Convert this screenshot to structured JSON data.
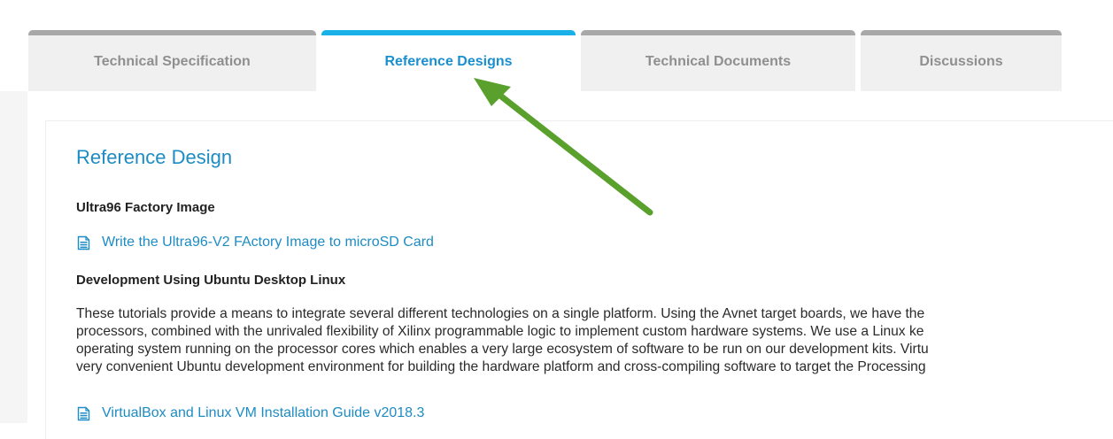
{
  "tabs": [
    {
      "label": "Technical Specification",
      "active": false
    },
    {
      "label": "Reference Designs",
      "active": true
    },
    {
      "label": "Technical Documents",
      "active": false
    },
    {
      "label": "Discussions",
      "active": false
    }
  ],
  "main": {
    "heading": "Reference Design",
    "sections": [
      {
        "title": "Ultra96 Factory Image",
        "links": [
          {
            "label": "Write the Ultra96-V2 FActory Image to microSD Card",
            "icon": "document-icon"
          }
        ]
      },
      {
        "title": "Development Using Ubuntu Desktop Linux",
        "paragraph_lines": [
          "These tutorials provide a means to integrate several different technologies on a single platform. Using the Avnet target boards, we have the",
          "processors, combined with the unrivaled flexibility of Xilinx programmable logic to implement custom hardware systems. We use a Linux ke",
          "operating system running on the processor cores which enables a very large ecosystem of software to be run on our development kits. Virtu",
          "very convenient Ubuntu development environment for building the hardware platform and cross-compiling software to target the Processing"
        ],
        "links": [
          {
            "label": "VirtualBox and Linux VM Installation Guide v2018.3",
            "icon": "document-icon"
          }
        ]
      }
    ]
  },
  "annotation": {
    "type": "arrow",
    "color": "#5aa02c",
    "points_to": "Reference Designs tab"
  },
  "colors": {
    "accent": "#1ab0e8",
    "link": "#1d8cc4",
    "tab_inactive_border": "#a8a8a8",
    "tab_inactive_bg": "#f0f0f0"
  }
}
